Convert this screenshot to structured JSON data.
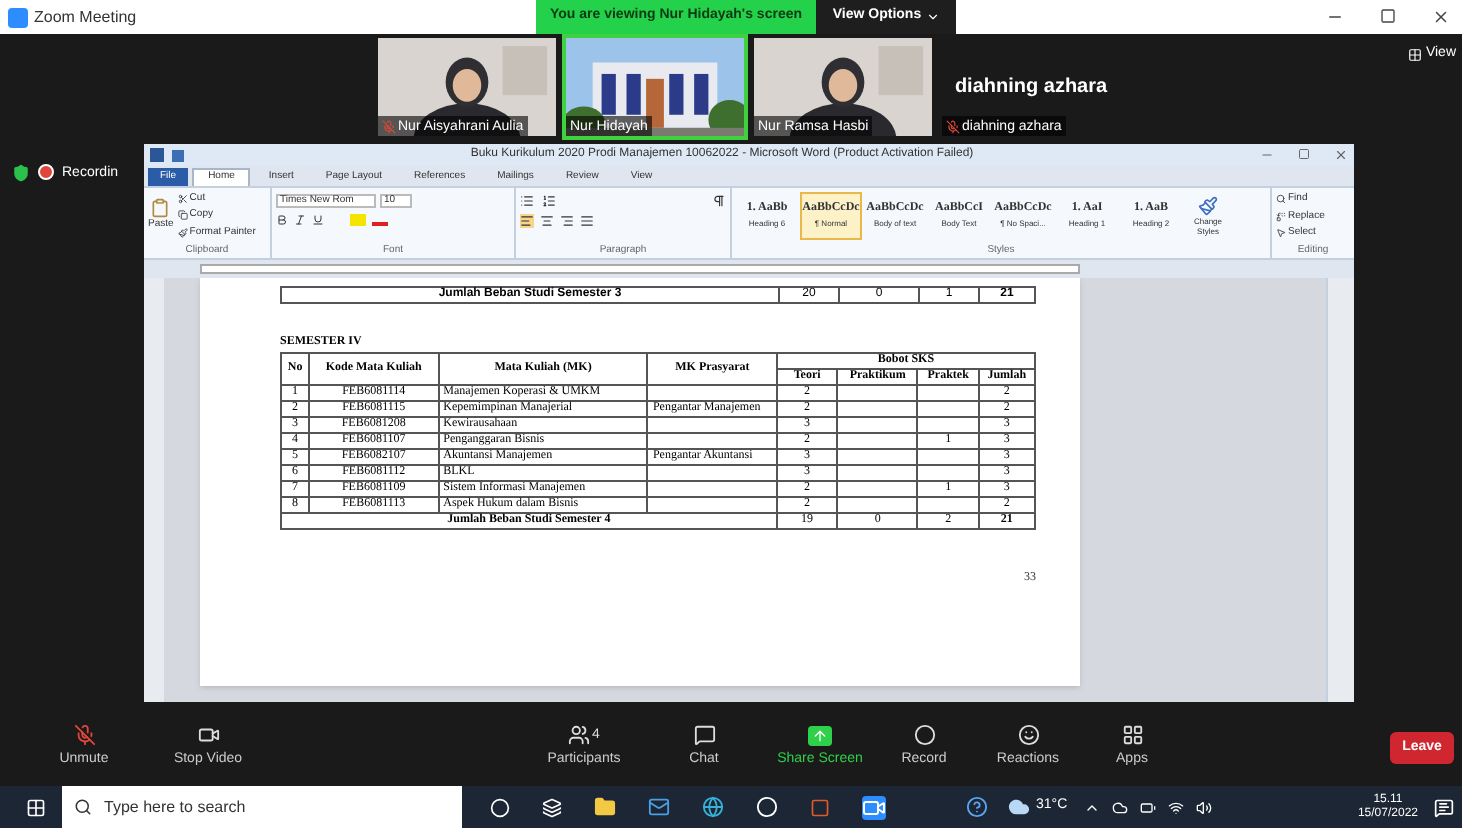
{
  "zoom_window": {
    "title": "Zoom Meeting",
    "banner": "You are viewing Nur Hidayah's screen",
    "view_options": "View Options",
    "view_button": "View",
    "recording": "Recordin"
  },
  "videos": [
    {
      "kind": "person",
      "name": "Nur Aisyahrani Aulia",
      "muted": true,
      "speaking": false
    },
    {
      "kind": "picture",
      "name": "Nur Hidayah",
      "muted": false,
      "speaking": true
    },
    {
      "kind": "person",
      "name": "Nur Ramsa Hasbi",
      "muted": false,
      "speaking": false
    },
    {
      "kind": "name",
      "name": "diahning azhara",
      "display": "diahning azhara",
      "muted": true,
      "speaking": false
    }
  ],
  "word": {
    "title": "Buku Kurikulum 2020 Prodi Manajemen 10062022 - Microsoft Word (Product Activation Failed)",
    "file_tab": "File",
    "tabs": [
      {
        "label": "Home",
        "selected": true
      },
      {
        "label": "Insert",
        "selected": false
      },
      {
        "label": "Page Layout",
        "selected": false
      },
      {
        "label": "References",
        "selected": false
      },
      {
        "label": "Mailings",
        "selected": false
      },
      {
        "label": "Review",
        "selected": false
      },
      {
        "label": "View",
        "selected": false
      }
    ],
    "clipboard": {
      "paste": "Paste",
      "cut": "Cut",
      "copy": "Copy",
      "format_painter": "Format Painter",
      "label": "Clipboard"
    },
    "font": {
      "name": "Times New Rom",
      "size": "10",
      "label": "Font"
    },
    "paragraph": {
      "label": "Paragraph"
    },
    "styles": [
      {
        "preview": "1. AaBb",
        "name": "Heading 6",
        "selected": false
      },
      {
        "preview": "AaBbCcDc",
        "name": "¶ Normal",
        "selected": true
      },
      {
        "preview": "AaBbCcDc",
        "name": "Body of text",
        "selected": false
      },
      {
        "preview": "AaBbCcI",
        "name": "Body Text",
        "selected": false
      },
      {
        "preview": "AaBbCcDc",
        "name": "¶ No Spaci...",
        "selected": false
      },
      {
        "preview": "1. AaI",
        "name": "Heading 1",
        "selected": false
      },
      {
        "preview": "1. AaB",
        "name": "Heading 2",
        "selected": false
      }
    ],
    "change_styles": "Change Styles",
    "styles_label": "Styles",
    "editing": {
      "find": "Find",
      "replace": "Replace",
      "select": "Select",
      "label": "Editing"
    },
    "document": {
      "prev_total": {
        "label": "Jumlah Beban Studi Semester 3",
        "teori": "20",
        "praktikum": "0",
        "praktek": "1",
        "jumlah": "21"
      },
      "heading": "SEMESTER IV",
      "columns": [
        "No",
        "Kode Mata Kuliah",
        "Mata Kuliah (MK)",
        "MK Prasyarat"
      ],
      "group_header": "Bobot SKS",
      "sub_columns": [
        "Teori",
        "Praktikum",
        "Praktek",
        "Jumlah"
      ],
      "rows": [
        [
          "1",
          "FEB6081114",
          "Manajemen Koperasi & UMKM",
          "",
          "2",
          "",
          "",
          "2"
        ],
        [
          "2",
          "FEB6081115",
          "Kepemimpinan Manajerial",
          "Pengantar Manajemen",
          "2",
          "",
          "",
          "2"
        ],
        [
          "3",
          "FEB6081208",
          "Kewirausahaan",
          "",
          "3",
          "",
          "",
          "3"
        ],
        [
          "4",
          "FEB6081107",
          "Penganggaran Bisnis",
          "",
          "2",
          "",
          "1",
          "3"
        ],
        [
          "5",
          "FEB6082107",
          "Akuntansi Manajemen",
          "Pengantar Akuntansi",
          "3",
          "",
          "",
          "3"
        ],
        [
          "6",
          "FEB6081112",
          "BLKL",
          "",
          "3",
          "",
          "",
          "3"
        ],
        [
          "7",
          "FEB6081109",
          "Sistem Informasi Manajemen",
          "",
          "2",
          "",
          "1",
          "3"
        ],
        [
          "8",
          "FEB6081113",
          "Aspek Hukum dalam Bisnis",
          "",
          "2",
          "",
          "",
          "2"
        ]
      ],
      "total": {
        "label": "Jumlah Beban Studi Semester 4",
        "teori": "19",
        "praktikum": "0",
        "praktek": "2",
        "jumlah": "21"
      },
      "page_number": "33"
    }
  },
  "toolbar": [
    {
      "kind": "mic",
      "label": "Unmute"
    },
    {
      "kind": "video",
      "label": "Stop Video"
    },
    {
      "kind": "participants",
      "label": "Participants",
      "count": "4"
    },
    {
      "kind": "chat",
      "label": "Chat"
    },
    {
      "kind": "share",
      "label": "Share Screen"
    },
    {
      "kind": "record",
      "label": "Record"
    },
    {
      "kind": "reactions",
      "label": "Reactions"
    },
    {
      "kind": "apps",
      "label": "Apps"
    }
  ],
  "leave": "Leave",
  "taskbar": {
    "search_placeholder": "Type here to search",
    "temperature": "31°C",
    "time": "15.11",
    "date": "15/07/2022"
  }
}
